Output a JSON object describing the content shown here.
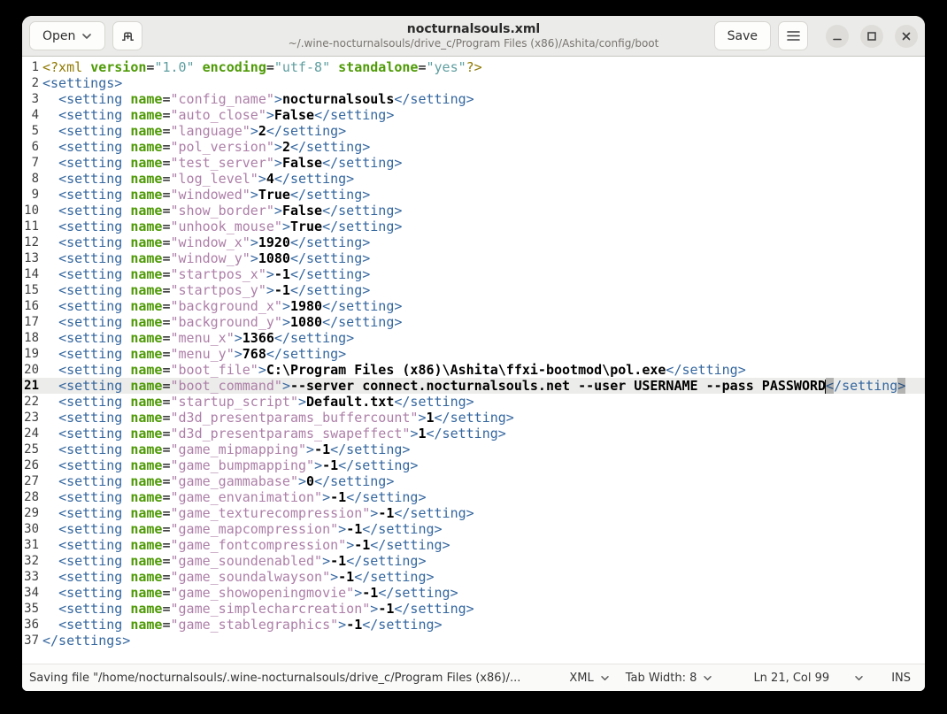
{
  "window": {
    "title": "nocturnalsouls.xml",
    "subtitle": "~/.wine-nocturnalsouls/drive_c/Program Files (x86)/Ashita/config/boot",
    "open_label": "Open",
    "save_label": "Save"
  },
  "icons": {
    "open_chevron": "chevron-down",
    "new_tab": "tab-new-plus",
    "menu": "hamburger",
    "minimize": "dash",
    "maximize": "square-outline",
    "close": "cross",
    "dropdown_chevron": "chevron-down"
  },
  "statusbar": {
    "message": "Saving file \"/home/nocturnalsouls/.wine-nocturnalsouls/drive_c/Program Files (x86)/...",
    "language": "XML",
    "tab_width": "Tab Width: 8",
    "position": "Ln 21, Col 99",
    "input_mode": "INS"
  },
  "editor": {
    "declaration": {
      "attrs": [
        [
          "version",
          "1.0"
        ],
        [
          "encoding",
          "utf-8"
        ],
        [
          "standalone",
          "yes"
        ]
      ]
    },
    "root_open": "<settings>",
    "root_close": "</settings>",
    "settings": [
      {
        "name": "config_name",
        "value": "nocturnalsouls"
      },
      {
        "name": "auto_close",
        "value": "False"
      },
      {
        "name": "language",
        "value": "2"
      },
      {
        "name": "pol_version",
        "value": "2"
      },
      {
        "name": "test_server",
        "value": "False"
      },
      {
        "name": "log_level",
        "value": "4"
      },
      {
        "name": "windowed",
        "value": "True"
      },
      {
        "name": "show_border",
        "value": "False"
      },
      {
        "name": "unhook_mouse",
        "value": "True"
      },
      {
        "name": "window_x",
        "value": "1920"
      },
      {
        "name": "window_y",
        "value": "1080"
      },
      {
        "name": "startpos_x",
        "value": "-1"
      },
      {
        "name": "startpos_y",
        "value": "-1"
      },
      {
        "name": "background_x",
        "value": "1980"
      },
      {
        "name": "background_y",
        "value": "1080"
      },
      {
        "name": "menu_x",
        "value": "1366"
      },
      {
        "name": "menu_y",
        "value": "768"
      },
      {
        "name": "boot_file",
        "value": "C:\\Program Files (x86)\\Ashita\\ffxi-bootmod\\pol.exe"
      },
      {
        "name": "boot_command",
        "value": "--server connect.nocturnalsouls.net --user USERNAME --pass PASSWORD"
      },
      {
        "name": "startup_script",
        "value": "Default.txt"
      },
      {
        "name": "d3d_presentparams_buffercount",
        "value": "1"
      },
      {
        "name": "d3d_presentparams_swapeffect",
        "value": "1"
      },
      {
        "name": "game_mipmapping",
        "value": "-1"
      },
      {
        "name": "game_bumpmapping",
        "value": "-1"
      },
      {
        "name": "game_gammabase",
        "value": "0"
      },
      {
        "name": "game_envanimation",
        "value": "-1"
      },
      {
        "name": "game_texturecompression",
        "value": "-1"
      },
      {
        "name": "game_mapcompression",
        "value": "-1"
      },
      {
        "name": "game_fontcompression",
        "value": "-1"
      },
      {
        "name": "game_soundenabled",
        "value": "-1"
      },
      {
        "name": "game_soundalwayson",
        "value": "-1"
      },
      {
        "name": "game_showopeningmovie",
        "value": "-1"
      },
      {
        "name": "game_simplecharcreation",
        "value": "-1"
      },
      {
        "name": "game_stablegraphics",
        "value": "-1"
      }
    ],
    "cursor": {
      "line": 21,
      "col": 99
    }
  },
  "colors": {
    "tag": "#35679f",
    "attr": "#4e9a06",
    "attr_value": "#ad7fa8",
    "decl": "#8f7902",
    "decl_value": "#5f9ea0",
    "current_line_bg": "#ececea",
    "bracket_bg": "#b3b3b1",
    "headerbar_bg": "#ebebe9",
    "window_control_bg": "#deddda"
  }
}
